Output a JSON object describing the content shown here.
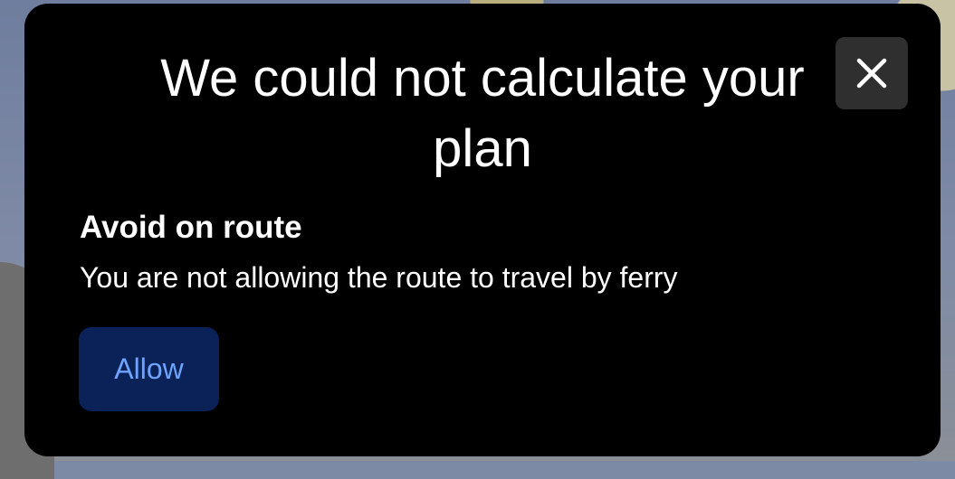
{
  "dialog": {
    "title": "We could not calculate your plan",
    "section_heading": "Avoid on route",
    "section_text": "You are not allowing the route to travel by ferry",
    "allow_label": "Allow",
    "close_icon": "close-icon"
  },
  "colors": {
    "dialog_background": "#000000",
    "close_button_background": "#2f2f2f",
    "allow_button_background": "#0a2257",
    "allow_button_text": "#6ea3ff",
    "text": "#ffffff"
  }
}
